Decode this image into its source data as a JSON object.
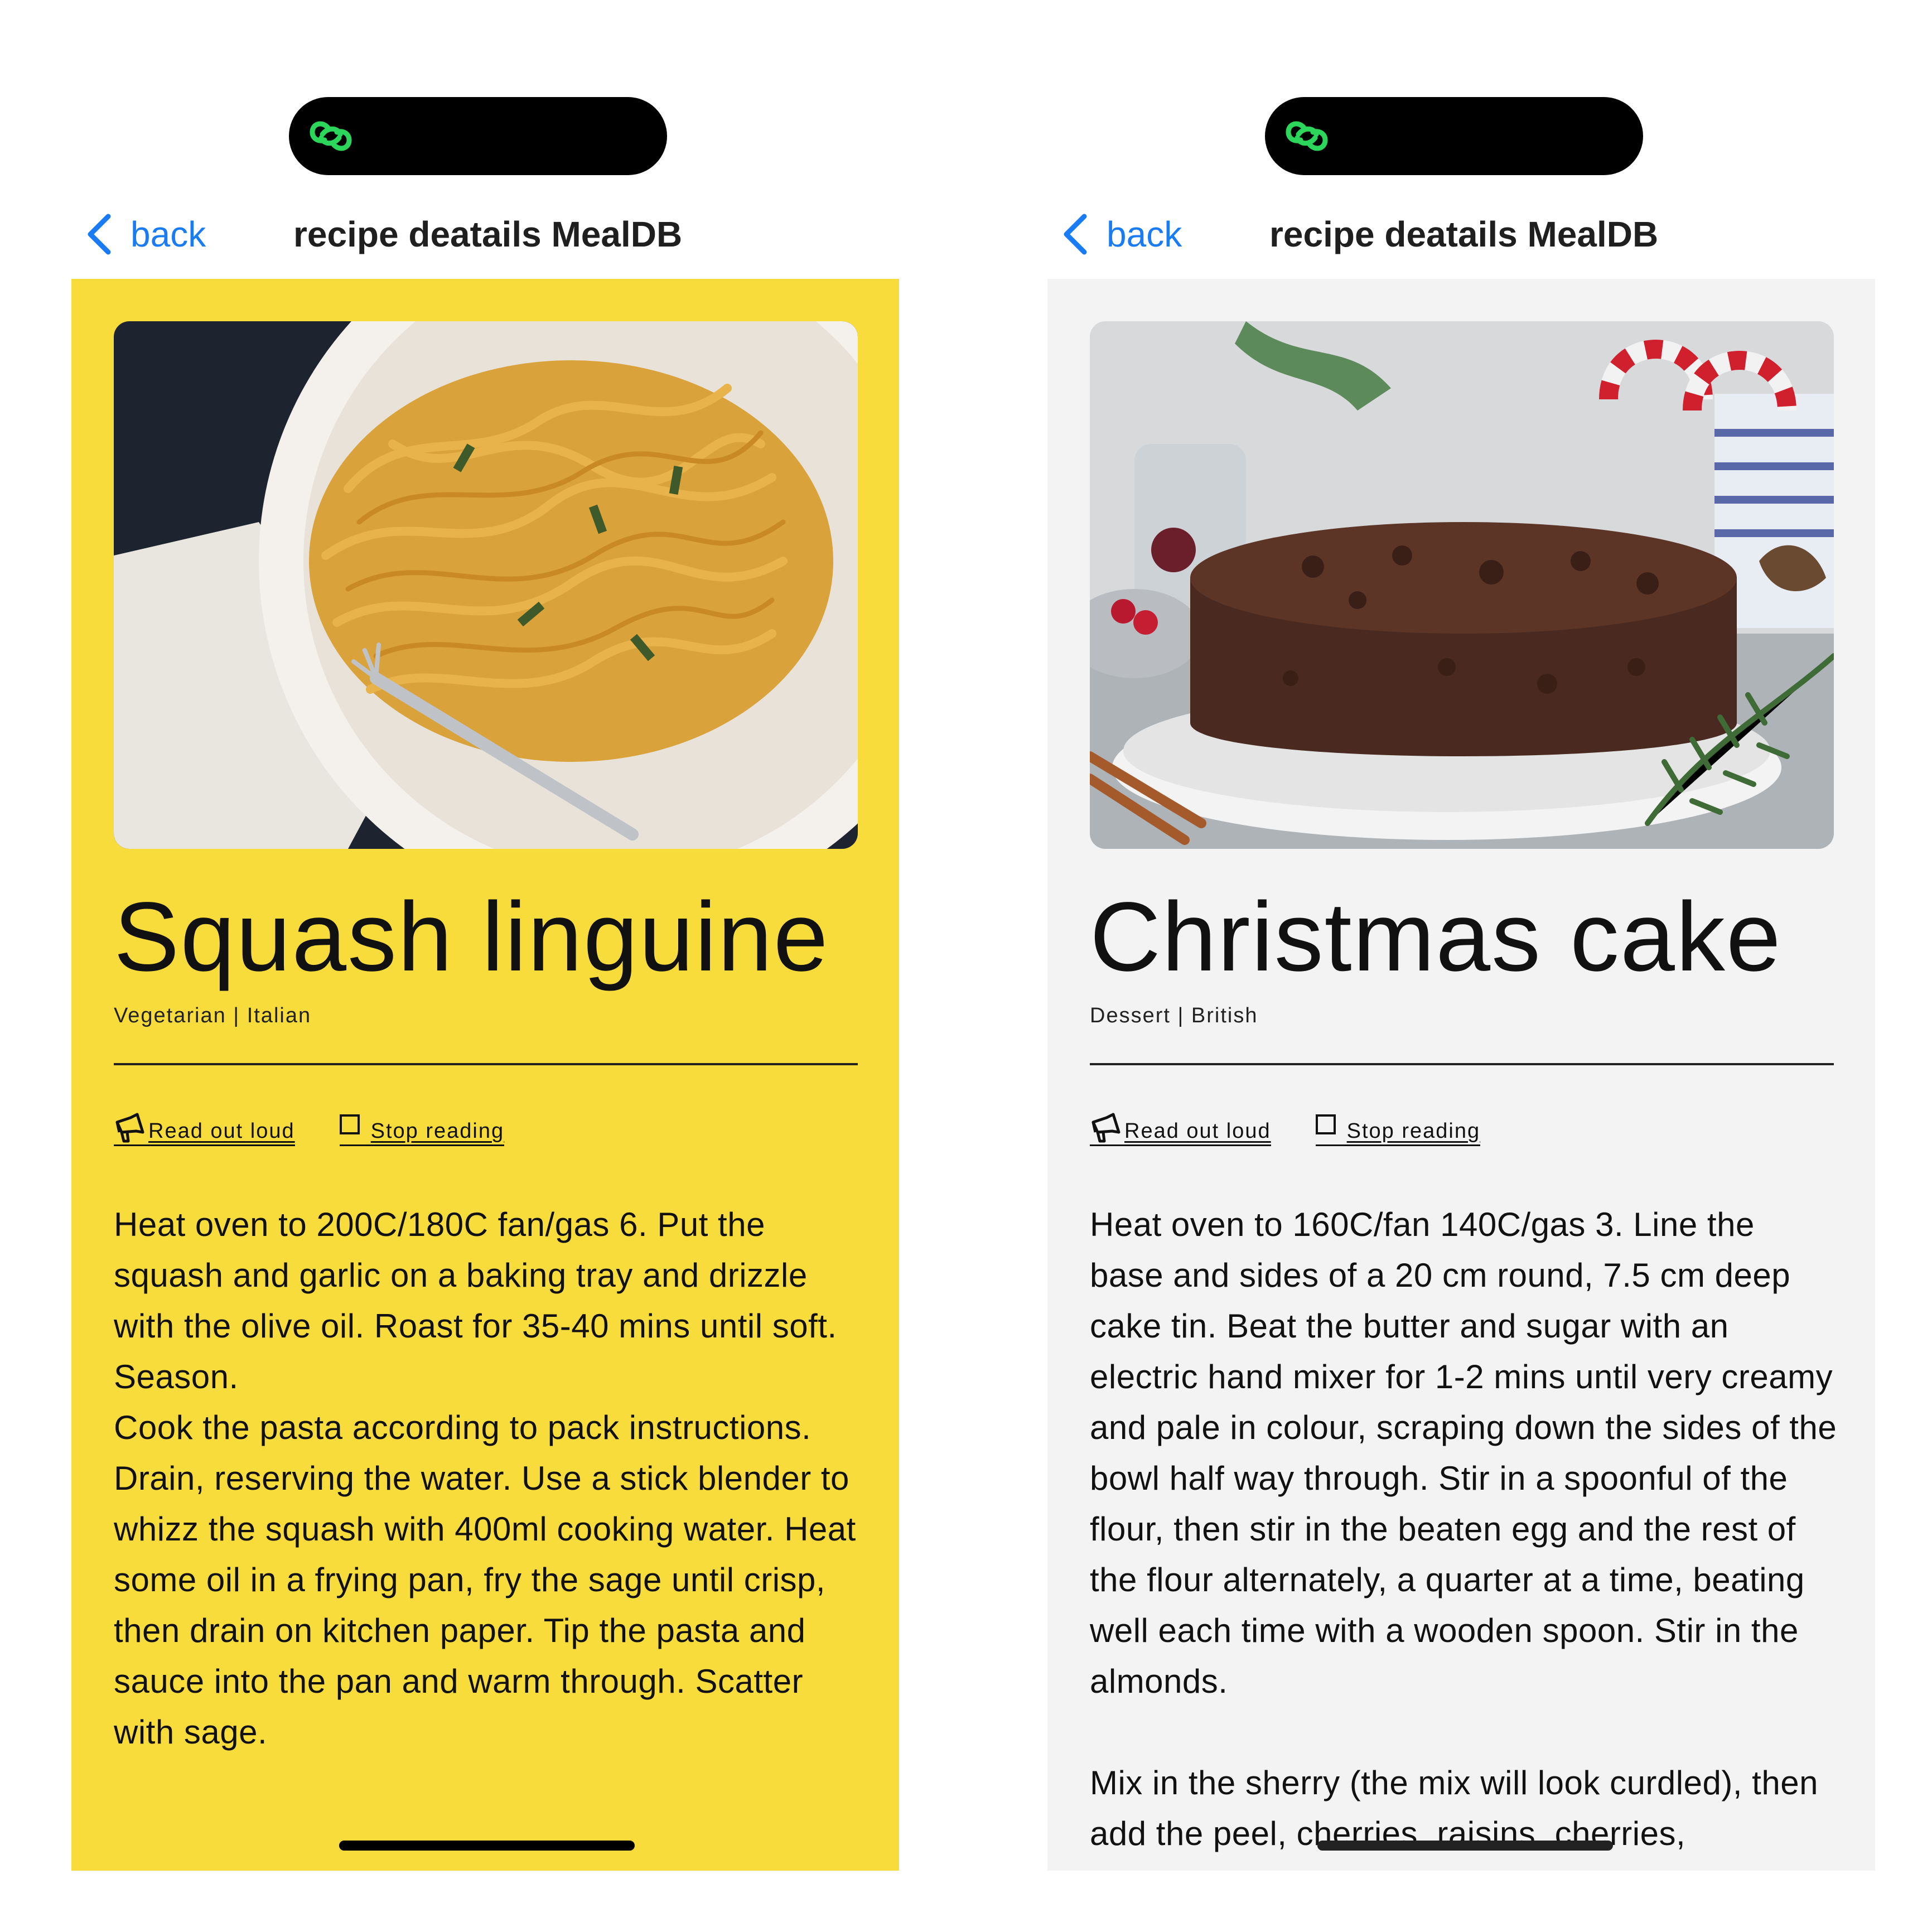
{
  "screens": [
    {
      "nav": {
        "back_label": "back",
        "title": "recipe deatails MealDB"
      },
      "recipe": {
        "name": "Squash linguine",
        "meta": "Vegetarian | Italian",
        "instructions": "Heat oven to 200C/180C fan/gas 6. Put the squash and garlic on a baking tray and drizzle with the olive oil. Roast for 35-40 mins until soft. Season.\nCook the pasta according to pack instructions. Drain, reserving the water. Use a stick blender to whizz the squash with 400ml cooking water. Heat some oil in a frying pan, fry the sage until crisp, then drain on kitchen paper. Tip the pasta and sauce into the pan and warm through. Scatter with sage."
      },
      "actions": {
        "read_label": "Read out loud",
        "stop_label": "Stop reading"
      },
      "theme": {
        "panel_bg": "#f8dc3c"
      }
    },
    {
      "nav": {
        "back_label": "back",
        "title": "recipe deatails MealDB"
      },
      "recipe": {
        "name": "Christmas cake",
        "meta": "Dessert | British",
        "instructions": "Heat oven to 160C/fan 140C/gas 3. Line the base and sides of a 20 cm round, 7.5 cm deep cake tin. Beat the butter and sugar with an electric hand mixer for 1-2 mins until very creamy and pale in colour, scraping down the sides of the bowl half way through. Stir in a spoonful of the flour, then stir in the beaten egg and the rest of the flour alternately, a quarter at a time, beating well each time with a wooden spoon. Stir in the almonds.\n\nMix in the sherry (the mix will look curdled), then add the peel, cherries, raisins, cherries,"
      },
      "actions": {
        "read_label": "Read out loud",
        "stop_label": "Stop reading"
      },
      "theme": {
        "panel_bg": "#f3f3f3"
      }
    }
  ],
  "colors": {
    "accent": "#1a7cf5",
    "island_icon": "#2bd65a"
  },
  "icons": [
    "link-icon",
    "chevron-left-icon",
    "megaphone-icon",
    "checkbox-icon"
  ]
}
